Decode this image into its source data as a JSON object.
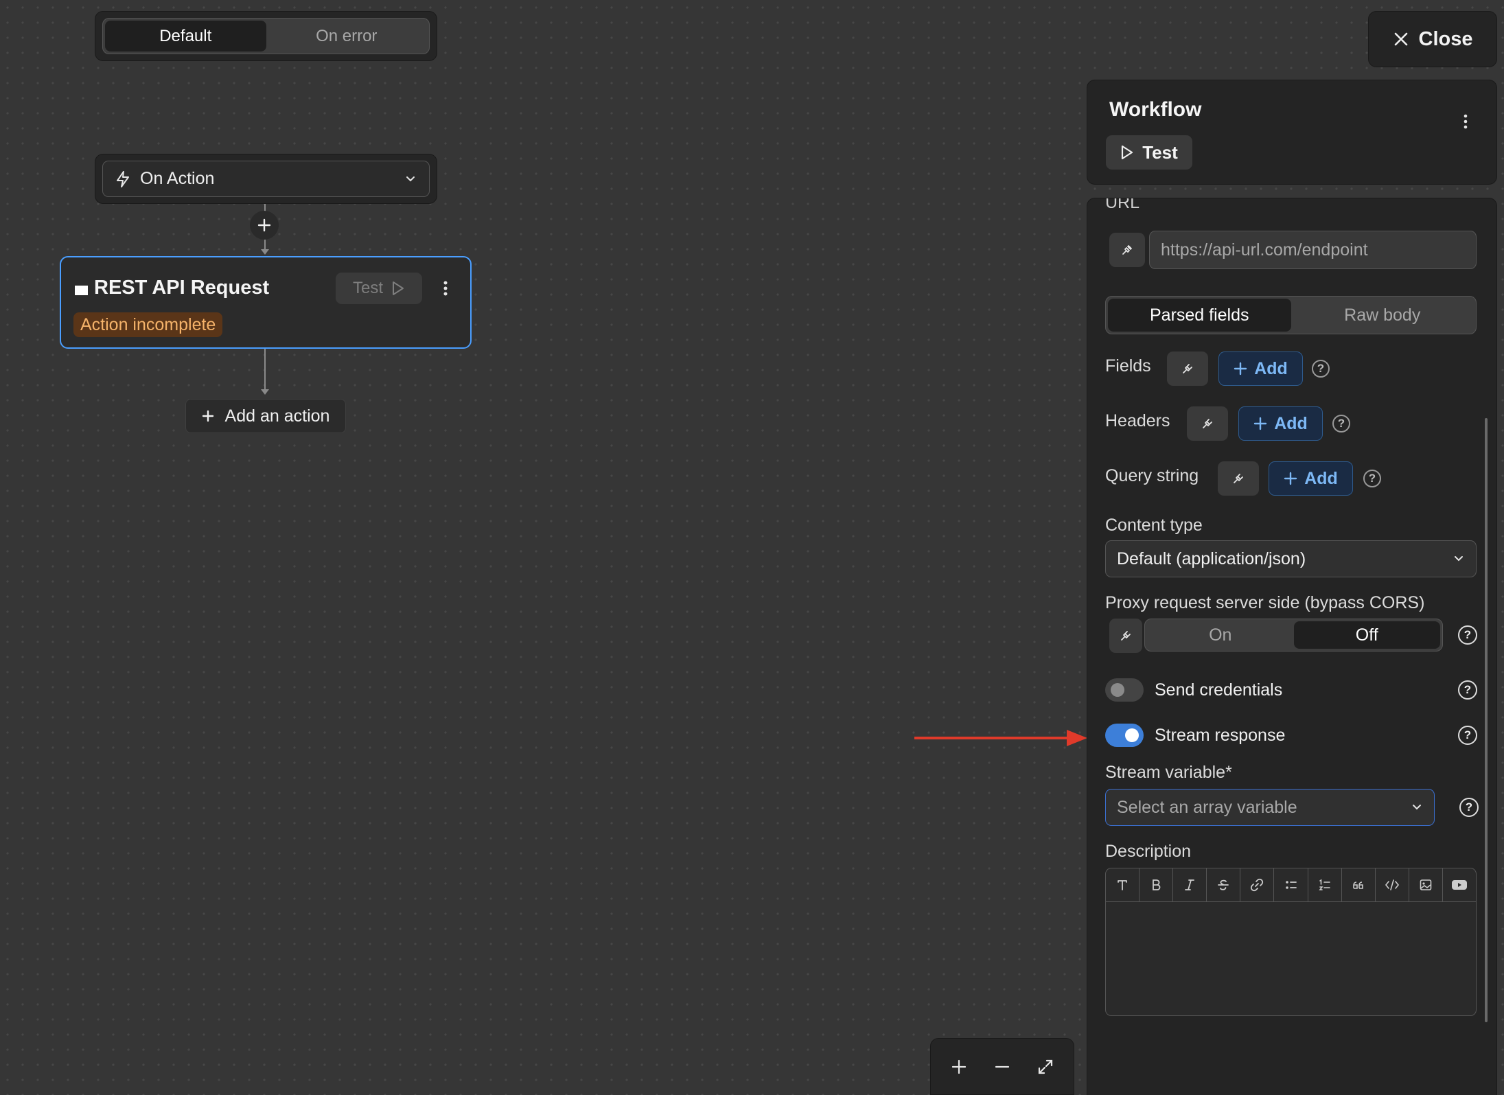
{
  "mode_switch": {
    "options": [
      "Default",
      "On error"
    ],
    "active": "Default"
  },
  "trigger": {
    "label": "On Action"
  },
  "node": {
    "title": "REST API Request",
    "test_label": "Test",
    "status_badge": "Action incomplete"
  },
  "add_action": {
    "label": "Add an action"
  },
  "close": {
    "label": "Close"
  },
  "workflow": {
    "title": "Workflow",
    "test_label": "Test"
  },
  "panel": {
    "url_label_partial": "URL",
    "url_placeholder": "https://api-url.com/endpoint",
    "body_tabs": [
      "Parsed fields",
      "Raw body"
    ],
    "body_tab_active": "Parsed fields",
    "fields_label": "Fields",
    "headers_label": "Headers",
    "query_label": "Query string",
    "add_label": "Add",
    "content_type_label": "Content type",
    "content_type_value": "Default (application/json)",
    "proxy_label": "Proxy request server side (bypass CORS)",
    "proxy_options": [
      "On",
      "Off"
    ],
    "proxy_active": "Off",
    "send_credentials_label": "Send credentials",
    "send_credentials_on": false,
    "stream_response_label": "Stream response",
    "stream_response_on": true,
    "stream_variable_label": "Stream variable",
    "required_mark": "*",
    "stream_variable_placeholder": "Select an array variable",
    "description_label": "Description",
    "editor_tools": [
      "text",
      "bold",
      "italic",
      "strikethrough",
      "link",
      "bulleted-list",
      "numbered-list",
      "quote",
      "code",
      "image",
      "video"
    ]
  },
  "colors": {
    "accent": "#4a9eff",
    "warning_bg": "#5a3518",
    "warning_text": "#f5b36a",
    "annotation_arrow": "#e03a2a"
  }
}
